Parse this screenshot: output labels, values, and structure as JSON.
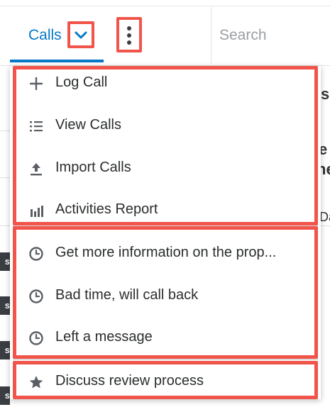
{
  "nav": {
    "calls_tab_label": "Calls",
    "search_placeholder": "Search"
  },
  "background_fragments": {
    "chip_text": "s",
    "fragment_1": "s",
    "fragment_2": "e",
    "fragment_3": "ne",
    "fragment_4": "Da"
  },
  "menu": {
    "actions": [
      {
        "label": "Log Call",
        "icon": "plus-icon"
      },
      {
        "label": "View Calls",
        "icon": "list-icon"
      },
      {
        "label": "Import Calls",
        "icon": "upload-icon"
      },
      {
        "label": "Activities Report",
        "icon": "bar-chart-icon"
      }
    ],
    "recent": [
      {
        "label": "Get more information on the prop...",
        "icon": "clock-icon"
      },
      {
        "label": "Bad time, will call back",
        "icon": "clock-icon"
      },
      {
        "label": "Left a message",
        "icon": "clock-icon"
      }
    ],
    "favorites": [
      {
        "label": "Discuss review process",
        "icon": "star-icon"
      }
    ]
  },
  "colors": {
    "accent": "#0679c8",
    "highlight": "#f0544a",
    "icon": "#5b5f63"
  }
}
